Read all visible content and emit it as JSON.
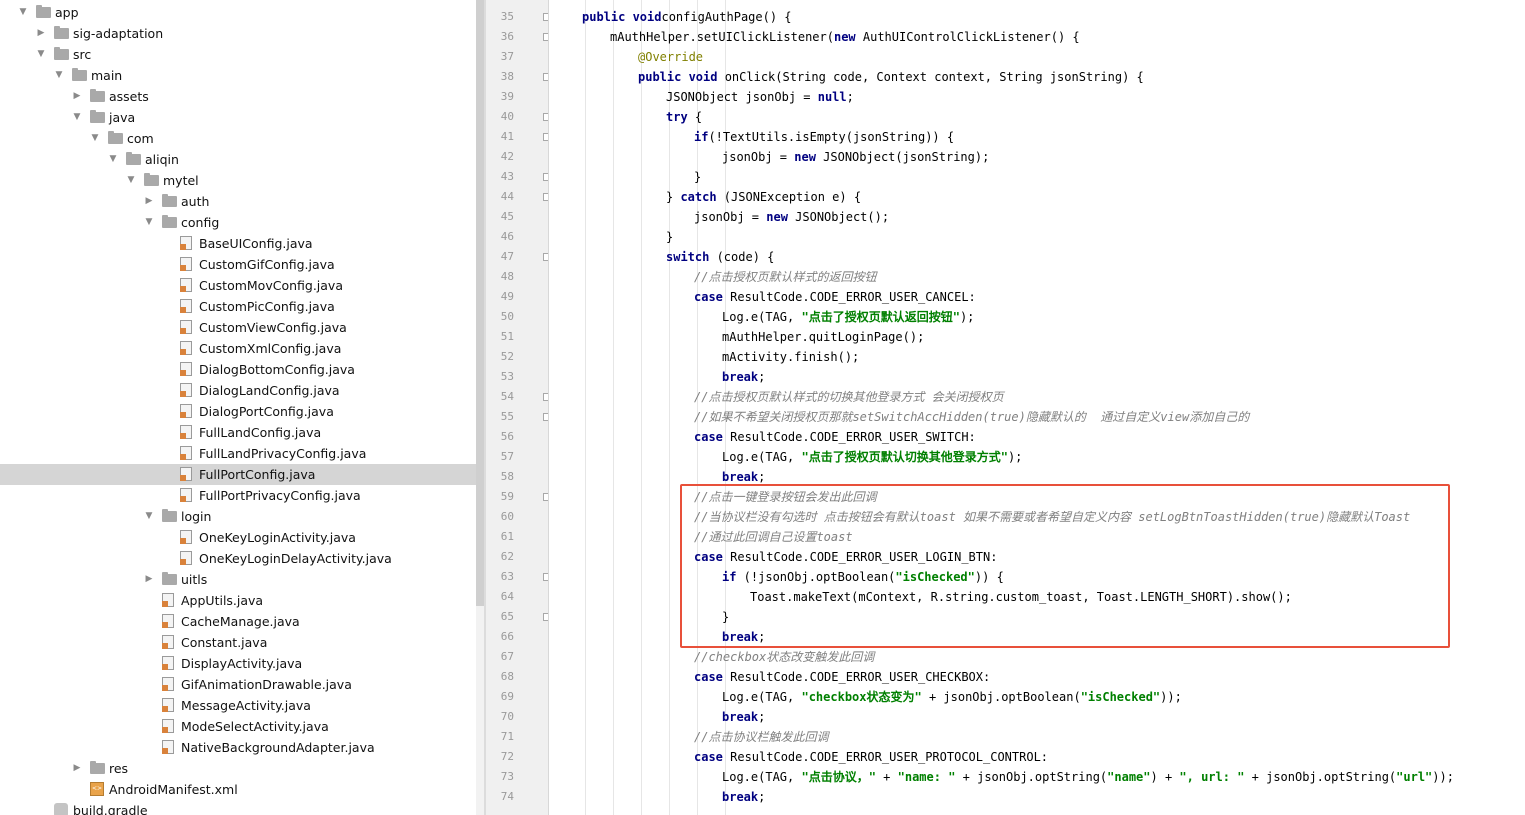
{
  "project_tree": {
    "items": [
      {
        "label": "app",
        "kind": "folder",
        "depth": 0,
        "state": "open"
      },
      {
        "label": "sig-adaptation",
        "kind": "folder",
        "depth": 1,
        "state": "closed"
      },
      {
        "label": "src",
        "kind": "folder",
        "depth": 1,
        "state": "open"
      },
      {
        "label": "main",
        "kind": "folder",
        "depth": 2,
        "state": "open"
      },
      {
        "label": "assets",
        "kind": "folder",
        "depth": 3,
        "state": "closed"
      },
      {
        "label": "java",
        "kind": "folder",
        "depth": 3,
        "state": "open"
      },
      {
        "label": "com",
        "kind": "folder",
        "depth": 4,
        "state": "open"
      },
      {
        "label": "aliqin",
        "kind": "folder",
        "depth": 5,
        "state": "open"
      },
      {
        "label": "mytel",
        "kind": "folder",
        "depth": 6,
        "state": "open"
      },
      {
        "label": "auth",
        "kind": "folder",
        "depth": 7,
        "state": "closed"
      },
      {
        "label": "config",
        "kind": "folder",
        "depth": 7,
        "state": "open"
      },
      {
        "label": "BaseUIConfig.java",
        "kind": "java",
        "depth": 8,
        "state": "leaf"
      },
      {
        "label": "CustomGifConfig.java",
        "kind": "java",
        "depth": 8,
        "state": "leaf"
      },
      {
        "label": "CustomMovConfig.java",
        "kind": "java",
        "depth": 8,
        "state": "leaf"
      },
      {
        "label": "CustomPicConfig.java",
        "kind": "java",
        "depth": 8,
        "state": "leaf"
      },
      {
        "label": "CustomViewConfig.java",
        "kind": "java",
        "depth": 8,
        "state": "leaf"
      },
      {
        "label": "CustomXmlConfig.java",
        "kind": "java",
        "depth": 8,
        "state": "leaf"
      },
      {
        "label": "DialogBottomConfig.java",
        "kind": "java",
        "depth": 8,
        "state": "leaf"
      },
      {
        "label": "DialogLandConfig.java",
        "kind": "java",
        "depth": 8,
        "state": "leaf"
      },
      {
        "label": "DialogPortConfig.java",
        "kind": "java",
        "depth": 8,
        "state": "leaf"
      },
      {
        "label": "FullLandConfig.java",
        "kind": "java",
        "depth": 8,
        "state": "leaf"
      },
      {
        "label": "FullLandPrivacyConfig.java",
        "kind": "java",
        "depth": 8,
        "state": "leaf"
      },
      {
        "label": "FullPortConfig.java",
        "kind": "java",
        "depth": 8,
        "state": "leaf",
        "selected": true
      },
      {
        "label": "FullPortPrivacyConfig.java",
        "kind": "java",
        "depth": 8,
        "state": "leaf"
      },
      {
        "label": "login",
        "kind": "folder",
        "depth": 7,
        "state": "open"
      },
      {
        "label": "OneKeyLoginActivity.java",
        "kind": "java",
        "depth": 8,
        "state": "leaf"
      },
      {
        "label": "OneKeyLoginDelayActivity.java",
        "kind": "java",
        "depth": 8,
        "state": "leaf"
      },
      {
        "label": "uitls",
        "kind": "folder",
        "depth": 7,
        "state": "closed"
      },
      {
        "label": "AppUtils.java",
        "kind": "java",
        "depth": 7,
        "state": "leaf"
      },
      {
        "label": "CacheManage.java",
        "kind": "java",
        "depth": 7,
        "state": "leaf"
      },
      {
        "label": "Constant.java",
        "kind": "java",
        "depth": 7,
        "state": "leaf"
      },
      {
        "label": "DisplayActivity.java",
        "kind": "java",
        "depth": 7,
        "state": "leaf"
      },
      {
        "label": "GifAnimationDrawable.java",
        "kind": "java",
        "depth": 7,
        "state": "leaf"
      },
      {
        "label": "MessageActivity.java",
        "kind": "java",
        "depth": 7,
        "state": "leaf"
      },
      {
        "label": "ModeSelectActivity.java",
        "kind": "java",
        "depth": 7,
        "state": "leaf"
      },
      {
        "label": "NativeBackgroundAdapter.java",
        "kind": "java",
        "depth": 7,
        "state": "leaf"
      },
      {
        "label": "res",
        "kind": "folder",
        "depth": 3,
        "state": "closed"
      },
      {
        "label": "AndroidManifest.xml",
        "kind": "xml",
        "depth": 3,
        "state": "leaf"
      },
      {
        "label": "build.gradle",
        "kind": "gradle",
        "depth": 1,
        "state": "leaf"
      }
    ]
  },
  "editor": {
    "lines": [
      {
        "n": "35",
        "indent": 0,
        "t": [
          [
            "kw",
            "public void"
          ],
          [
            "",
            "configAuthPage() {"
          ]
        ]
      },
      {
        "n": "36",
        "indent": 1,
        "t": [
          [
            "",
            "mAuthHelper.setUIClickListener("
          ],
          [
            "kw",
            "new"
          ],
          [
            "",
            " AuthUIControlClickListener() {"
          ]
        ]
      },
      {
        "n": "37",
        "indent": 2,
        "t": [
          [
            "an",
            "@Override"
          ]
        ]
      },
      {
        "n": "38",
        "indent": 2,
        "t": [
          [
            "kw",
            "public void"
          ],
          [
            "",
            " onClick(String code, Context context, String jsonString) {"
          ]
        ]
      },
      {
        "n": "39",
        "indent": 3,
        "t": [
          [
            "",
            "JSONObject jsonObj = "
          ],
          [
            "kw",
            "null"
          ],
          [
            "",
            ";"
          ]
        ]
      },
      {
        "n": "40",
        "indent": 3,
        "t": [
          [
            "kw",
            "try"
          ],
          [
            "",
            " {"
          ]
        ]
      },
      {
        "n": "41",
        "indent": 4,
        "t": [
          [
            "kw",
            "if"
          ],
          [
            "",
            "(!TextUtils.isEmpty(jsonString)) {"
          ]
        ]
      },
      {
        "n": "42",
        "indent": 5,
        "t": [
          [
            "",
            "jsonObj = "
          ],
          [
            "kw",
            "new"
          ],
          [
            "",
            " JSONObject(jsonString);"
          ]
        ]
      },
      {
        "n": "43",
        "indent": 4,
        "t": [
          [
            "",
            "}"
          ]
        ]
      },
      {
        "n": "44",
        "indent": 3,
        "t": [
          [
            "",
            "} "
          ],
          [
            "kw",
            "catch"
          ],
          [
            "",
            " (JSONException e) {"
          ]
        ]
      },
      {
        "n": "45",
        "indent": 4,
        "t": [
          [
            "",
            "jsonObj = "
          ],
          [
            "kw",
            "new"
          ],
          [
            "",
            " JSONObject();"
          ]
        ]
      },
      {
        "n": "46",
        "indent": 3,
        "t": [
          [
            "",
            "}"
          ]
        ]
      },
      {
        "n": "47",
        "indent": 3,
        "t": [
          [
            "kw",
            "switch"
          ],
          [
            "",
            " (code) {"
          ]
        ]
      },
      {
        "n": "48",
        "indent": 4,
        "t": [
          [
            "cm",
            "//点击授权页默认样式的返回按钮"
          ]
        ]
      },
      {
        "n": "49",
        "indent": 4,
        "t": [
          [
            "kw",
            "case"
          ],
          [
            "",
            " ResultCode.CODE_ERROR_USER_CANCEL:"
          ]
        ]
      },
      {
        "n": "50",
        "indent": 5,
        "t": [
          [
            "",
            "Log.e(TAG, "
          ],
          [
            "st",
            "\"点击了授权页默认返回按钮\""
          ],
          [
            "",
            ");"
          ]
        ]
      },
      {
        "n": "51",
        "indent": 5,
        "t": [
          [
            "",
            "mAuthHelper.quitLoginPage();"
          ]
        ]
      },
      {
        "n": "52",
        "indent": 5,
        "t": [
          [
            "",
            "mActivity.finish();"
          ]
        ]
      },
      {
        "n": "53",
        "indent": 5,
        "t": [
          [
            "kw",
            "break"
          ],
          [
            "",
            ";"
          ]
        ]
      },
      {
        "n": "54",
        "indent": 4,
        "t": [
          [
            "cm",
            "//点击授权页默认样式的切换其他登录方式 会关闭授权页"
          ]
        ]
      },
      {
        "n": "55",
        "indent": 4,
        "t": [
          [
            "cm",
            "//如果不希望关闭授权页那就setSwitchAccHidden(true)隐藏默认的  通过自定义view添加自己的"
          ]
        ]
      },
      {
        "n": "56",
        "indent": 4,
        "t": [
          [
            "kw",
            "case"
          ],
          [
            "",
            " ResultCode.CODE_ERROR_USER_SWITCH:"
          ]
        ]
      },
      {
        "n": "57",
        "indent": 5,
        "t": [
          [
            "",
            "Log.e(TAG, "
          ],
          [
            "st",
            "\"点击了授权页默认切换其他登录方式\""
          ],
          [
            "",
            ");"
          ]
        ]
      },
      {
        "n": "58",
        "indent": 5,
        "t": [
          [
            "kw",
            "break"
          ],
          [
            "",
            ";"
          ]
        ]
      },
      {
        "n": "59",
        "indent": 4,
        "t": [
          [
            "cm",
            "//点击一键登录按钮会发出此回调"
          ]
        ]
      },
      {
        "n": "60",
        "indent": 4,
        "t": [
          [
            "cm",
            "//当协议栏没有勾选时 点击按钮会有默认toast 如果不需要或者希望自定义内容 setLogBtnToastHidden(true)隐藏默认Toast"
          ]
        ]
      },
      {
        "n": "61",
        "indent": 4,
        "t": [
          [
            "cm",
            "//通过此回调自己设置toast"
          ]
        ]
      },
      {
        "n": "62",
        "indent": 4,
        "t": [
          [
            "kw",
            "case"
          ],
          [
            "",
            " ResultCode.CODE_ERROR_USER_LOGIN_BTN:"
          ]
        ]
      },
      {
        "n": "63",
        "indent": 5,
        "t": [
          [
            "kw",
            "if"
          ],
          [
            "",
            " (!jsonObj.optBoolean("
          ],
          [
            "st",
            "\"isChecked\""
          ],
          [
            "",
            ")) {"
          ]
        ]
      },
      {
        "n": "64",
        "indent": 6,
        "t": [
          [
            "",
            "Toast.makeText(mContext, R.string.custom_toast, Toast.LENGTH_SHORT).show();"
          ]
        ]
      },
      {
        "n": "65",
        "indent": 5,
        "t": [
          [
            "",
            "}"
          ]
        ]
      },
      {
        "n": "66",
        "indent": 5,
        "t": [
          [
            "kw",
            "break"
          ],
          [
            "",
            ";"
          ]
        ]
      },
      {
        "n": "67",
        "indent": 4,
        "t": [
          [
            "cm",
            "//checkbox状态改变触发此回调"
          ]
        ]
      },
      {
        "n": "68",
        "indent": 4,
        "t": [
          [
            "kw",
            "case"
          ],
          [
            "",
            " ResultCode.CODE_ERROR_USER_CHECKBOX:"
          ]
        ]
      },
      {
        "n": "69",
        "indent": 5,
        "t": [
          [
            "",
            "Log.e(TAG, "
          ],
          [
            "st",
            "\"checkbox状态变为\""
          ],
          [
            "",
            " + jsonObj.optBoolean("
          ],
          [
            "st",
            "\"isChecked\""
          ],
          [
            "",
            "));"
          ]
        ]
      },
      {
        "n": "70",
        "indent": 5,
        "t": [
          [
            "kw",
            "break"
          ],
          [
            "",
            ";"
          ]
        ]
      },
      {
        "n": "71",
        "indent": 4,
        "t": [
          [
            "cm",
            "//点击协议栏触发此回调"
          ]
        ]
      },
      {
        "n": "72",
        "indent": 4,
        "t": [
          [
            "kw",
            "case"
          ],
          [
            "",
            " ResultCode.CODE_ERROR_USER_PROTOCOL_CONTROL:"
          ]
        ]
      },
      {
        "n": "73",
        "indent": 5,
        "t": [
          [
            "",
            "Log.e(TAG, "
          ],
          [
            "st",
            "\"点击协议，\""
          ],
          [
            "",
            " + "
          ],
          [
            "st",
            "\"name: \""
          ],
          [
            "",
            " + jsonObj.optString("
          ],
          [
            "st",
            "\"name\""
          ],
          [
            "",
            ") + "
          ],
          [
            "st",
            "\", url: \""
          ],
          [
            "",
            " + jsonObj.optString("
          ],
          [
            "st",
            "\"url\""
          ],
          [
            "",
            "));"
          ]
        ]
      },
      {
        "n": "74",
        "indent": 5,
        "t": [
          [
            "kw",
            "break"
          ],
          [
            "",
            ";"
          ]
        ]
      }
    ],
    "highlight_color": "#e8503a"
  }
}
